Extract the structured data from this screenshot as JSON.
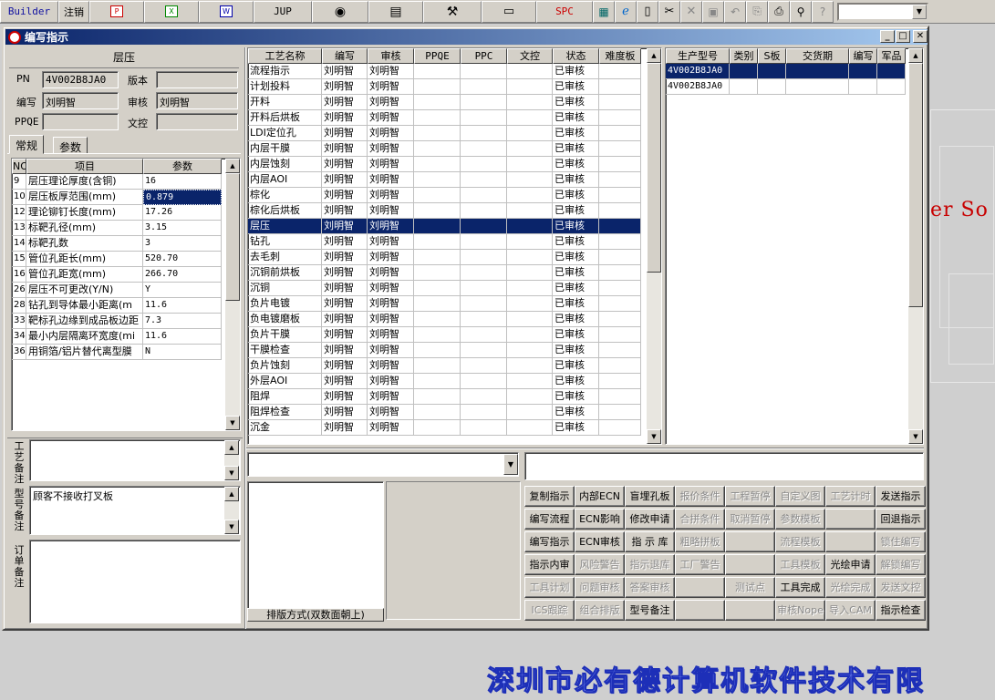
{
  "toolbar": {
    "builder_label": "Builder",
    "logout_label": "注销",
    "jup_label": "JUP",
    "spc_label": "SPC",
    "icons": [
      "pdf-icon",
      "excel-icon",
      "word-icon",
      "eye-icon",
      "database-icon",
      "tools-icon",
      "computer-icon",
      "calendar-icon",
      "ie-icon",
      "new-file-icon",
      "cut-icon",
      "cancel-icon",
      "save-icon",
      "undo-icon",
      "preview-icon",
      "print-icon",
      "find-icon",
      "help-icon"
    ]
  },
  "window": {
    "title": "编写指示"
  },
  "desktop": {
    "right_text": "er So",
    "company_text": "深圳市必有德计算机软件技术有限"
  },
  "left_panel": {
    "header": "层压",
    "pn_label": "PN",
    "pn_value": "4V002B8JA0",
    "version_label": "版本",
    "version_value": "",
    "writer_label": "编写",
    "writer_value": "刘明智",
    "reviewer_label": "审核",
    "reviewer_value": "刘明智",
    "ppqe_label": "PPQE",
    "ppqe_value": "",
    "doc_control_label": "文控",
    "doc_control_value": "",
    "tabs": [
      "常规",
      "参数"
    ],
    "param_columns": [
      "NO",
      "项目",
      "参数"
    ],
    "params": [
      {
        "no": "9",
        "item": "层压理论厚度(含铜)",
        "value": "16"
      },
      {
        "no": "10",
        "item": "层压板厚范围(mm)",
        "value": "0.879"
      },
      {
        "no": "12",
        "item": "理论铆钉长度(mm)",
        "value": "17.26"
      },
      {
        "no": "13",
        "item": "标靶孔径(mm)",
        "value": "3.15"
      },
      {
        "no": "14",
        "item": "标靶孔数",
        "value": "3"
      },
      {
        "no": "15",
        "item": "管位孔距长(mm)",
        "value": "520.70"
      },
      {
        "no": "16",
        "item": "管位孔距宽(mm)",
        "value": "266.70"
      },
      {
        "no": "26",
        "item": "层压不可更改(Y/N)",
        "value": "Y"
      },
      {
        "no": "28",
        "item": "钻孔到导体最小距离(m",
        "value": "11.6"
      },
      {
        "no": "33",
        "item": "靶标孔边缘到成品板边距",
        "value": "7.3"
      },
      {
        "no": "34",
        "item": "最小内层隔离环宽度(mi",
        "value": "11.6"
      },
      {
        "no": "36",
        "item": "用铜箔/铝片替代离型膜",
        "value": "N"
      }
    ],
    "process_note_label": "工艺备注",
    "process_note": "",
    "model_note_label": "型号备注",
    "model_note": "顾客不接收打叉板",
    "order_note_label": "订单备注",
    "order_note": ""
  },
  "process_grid": {
    "columns": [
      "工艺名称",
      "编写",
      "审核",
      "PPQE",
      "PPC",
      "文控",
      "状态",
      "难度板"
    ],
    "rows": [
      {
        "name": "流程指示",
        "writer": "刘明智",
        "reviewer": "刘明智",
        "ppqe": "",
        "ppc": "",
        "doc": "",
        "status": "已审核",
        "diff": ""
      },
      {
        "name": "计划投料",
        "writer": "刘明智",
        "reviewer": "刘明智",
        "ppqe": "",
        "ppc": "",
        "doc": "",
        "status": "已审核",
        "diff": ""
      },
      {
        "name": "开料",
        "writer": "刘明智",
        "reviewer": "刘明智",
        "ppqe": "",
        "ppc": "",
        "doc": "",
        "status": "已审核",
        "diff": ""
      },
      {
        "name": "开料后烘板",
        "writer": "刘明智",
        "reviewer": "刘明智",
        "ppqe": "",
        "ppc": "",
        "doc": "",
        "status": "已审核",
        "diff": ""
      },
      {
        "name": "LDI定位孔",
        "writer": "刘明智",
        "reviewer": "刘明智",
        "ppqe": "",
        "ppc": "",
        "doc": "",
        "status": "已审核",
        "diff": ""
      },
      {
        "name": "内层干膜",
        "writer": "刘明智",
        "reviewer": "刘明智",
        "ppqe": "",
        "ppc": "",
        "doc": "",
        "status": "已审核",
        "diff": ""
      },
      {
        "name": "内层蚀刻",
        "writer": "刘明智",
        "reviewer": "刘明智",
        "ppqe": "",
        "ppc": "",
        "doc": "",
        "status": "已审核",
        "diff": ""
      },
      {
        "name": "内层AOI",
        "writer": "刘明智",
        "reviewer": "刘明智",
        "ppqe": "",
        "ppc": "",
        "doc": "",
        "status": "已审核",
        "diff": ""
      },
      {
        "name": "棕化",
        "writer": "刘明智",
        "reviewer": "刘明智",
        "ppqe": "",
        "ppc": "",
        "doc": "",
        "status": "已审核",
        "diff": ""
      },
      {
        "name": "棕化后烘板",
        "writer": "刘明智",
        "reviewer": "刘明智",
        "ppqe": "",
        "ppc": "",
        "doc": "",
        "status": "已审核",
        "diff": ""
      },
      {
        "name": "层压",
        "writer": "刘明智",
        "reviewer": "刘明智",
        "ppqe": "",
        "ppc": "",
        "doc": "",
        "status": "已审核",
        "diff": "",
        "selected": true
      },
      {
        "name": "钻孔",
        "writer": "刘明智",
        "reviewer": "刘明智",
        "ppqe": "",
        "ppc": "",
        "doc": "",
        "status": "已审核",
        "diff": ""
      },
      {
        "name": "去毛刺",
        "writer": "刘明智",
        "reviewer": "刘明智",
        "ppqe": "",
        "ppc": "",
        "doc": "",
        "status": "已审核",
        "diff": ""
      },
      {
        "name": "沉铜前烘板",
        "writer": "刘明智",
        "reviewer": "刘明智",
        "ppqe": "",
        "ppc": "",
        "doc": "",
        "status": "已审核",
        "diff": ""
      },
      {
        "name": "沉铜",
        "writer": "刘明智",
        "reviewer": "刘明智",
        "ppqe": "",
        "ppc": "",
        "doc": "",
        "status": "已审核",
        "diff": ""
      },
      {
        "name": "负片电镀",
        "writer": "刘明智",
        "reviewer": "刘明智",
        "ppqe": "",
        "ppc": "",
        "doc": "",
        "status": "已审核",
        "diff": ""
      },
      {
        "name": "负电镀磨板",
        "writer": "刘明智",
        "reviewer": "刘明智",
        "ppqe": "",
        "ppc": "",
        "doc": "",
        "status": "已审核",
        "diff": ""
      },
      {
        "name": "负片干膜",
        "writer": "刘明智",
        "reviewer": "刘明智",
        "ppqe": "",
        "ppc": "",
        "doc": "",
        "status": "已审核",
        "diff": ""
      },
      {
        "name": "干膜检查",
        "writer": "刘明智",
        "reviewer": "刘明智",
        "ppqe": "",
        "ppc": "",
        "doc": "",
        "status": "已审核",
        "diff": ""
      },
      {
        "name": "负片蚀刻",
        "writer": "刘明智",
        "reviewer": "刘明智",
        "ppqe": "",
        "ppc": "",
        "doc": "",
        "status": "已审核",
        "diff": ""
      },
      {
        "name": "外层AOI",
        "writer": "刘明智",
        "reviewer": "刘明智",
        "ppqe": "",
        "ppc": "",
        "doc": "",
        "status": "已审核",
        "diff": ""
      },
      {
        "name": "阻焊",
        "writer": "刘明智",
        "reviewer": "刘明智",
        "ppqe": "",
        "ppc": "",
        "doc": "",
        "status": "已审核",
        "diff": ""
      },
      {
        "name": "阻焊检查",
        "writer": "刘明智",
        "reviewer": "刘明智",
        "ppqe": "",
        "ppc": "",
        "doc": "",
        "status": "已审核",
        "diff": ""
      },
      {
        "name": "沉金",
        "writer": "刘明智",
        "reviewer": "刘明智",
        "ppqe": "",
        "ppc": "",
        "doc": "",
        "status": "已审核",
        "diff": ""
      }
    ]
  },
  "model_grid": {
    "columns": [
      "生产型号",
      "类别",
      "S板",
      "交货期",
      "编写",
      "军品"
    ],
    "rows": [
      {
        "model": "4V002B8JA0",
        "type": "",
        "s": "",
        "due": "",
        "writer": "",
        "mil": "",
        "selected": true
      },
      {
        "model": "4V002B8JA0",
        "type": "",
        "s": "",
        "due": "",
        "writer": "",
        "mil": ""
      }
    ]
  },
  "layout_list": {
    "combo_value": "",
    "footer_label": "排版方式(双数面朝上)"
  },
  "actions": {
    "input_value": "",
    "buttons": [
      [
        {
          "label": "复制指示",
          "enabled": true
        },
        {
          "label": "内部ECN",
          "enabled": true
        },
        {
          "label": "盲埋孔板",
          "enabled": true
        },
        {
          "label": "报价条件",
          "enabled": false
        },
        {
          "label": "工程暂停",
          "enabled": false
        },
        {
          "label": "自定义图",
          "enabled": false
        },
        {
          "label": "工艺计时",
          "enabled": false
        },
        {
          "label": "发送指示",
          "enabled": true
        }
      ],
      [
        {
          "label": "编写流程",
          "enabled": true
        },
        {
          "label": "ECN影响",
          "enabled": true
        },
        {
          "label": "修改申请",
          "enabled": true
        },
        {
          "label": "合拼条件",
          "enabled": false
        },
        {
          "label": "取消暂停",
          "enabled": false
        },
        {
          "label": "参数模板",
          "enabled": false
        },
        {
          "label": "",
          "enabled": false
        },
        {
          "label": "回退指示",
          "enabled": true
        }
      ],
      [
        {
          "label": "编写指示",
          "enabled": true
        },
        {
          "label": "ECN审核",
          "enabled": true
        },
        {
          "label": "指 示 库",
          "enabled": true
        },
        {
          "label": "粗略拼板",
          "enabled": false
        },
        {
          "label": "",
          "enabled": false
        },
        {
          "label": "流程模板",
          "enabled": false
        },
        {
          "label": "",
          "enabled": false
        },
        {
          "label": "锁住编写",
          "enabled": false
        }
      ],
      [
        {
          "label": "指示内审",
          "enabled": true
        },
        {
          "label": "风险警告",
          "enabled": false
        },
        {
          "label": "指示退库",
          "enabled": false
        },
        {
          "label": "工厂警告",
          "enabled": false
        },
        {
          "label": "",
          "enabled": false
        },
        {
          "label": "工具模板",
          "enabled": false
        },
        {
          "label": "光绘申请",
          "enabled": true
        },
        {
          "label": "解锁编写",
          "enabled": false
        }
      ],
      [
        {
          "label": "工具计划",
          "enabled": false
        },
        {
          "label": "问题审核",
          "enabled": false
        },
        {
          "label": "答案审核",
          "enabled": false
        },
        {
          "label": "",
          "enabled": false
        },
        {
          "label": "测试点",
          "enabled": false
        },
        {
          "label": "工具完成",
          "enabled": true
        },
        {
          "label": "光绘完成",
          "enabled": false
        },
        {
          "label": "发送文控",
          "enabled": false
        }
      ],
      [
        {
          "label": "ICS跟踪",
          "enabled": false
        },
        {
          "label": "组合排版",
          "enabled": false
        },
        {
          "label": "型号备注",
          "enabled": true
        },
        {
          "label": "",
          "enabled": false
        },
        {
          "label": "",
          "enabled": false
        },
        {
          "label": "审核Nope",
          "enabled": false
        },
        {
          "label": "导入CAM",
          "enabled": false
        },
        {
          "label": "指示检查",
          "enabled": true
        }
      ]
    ]
  }
}
